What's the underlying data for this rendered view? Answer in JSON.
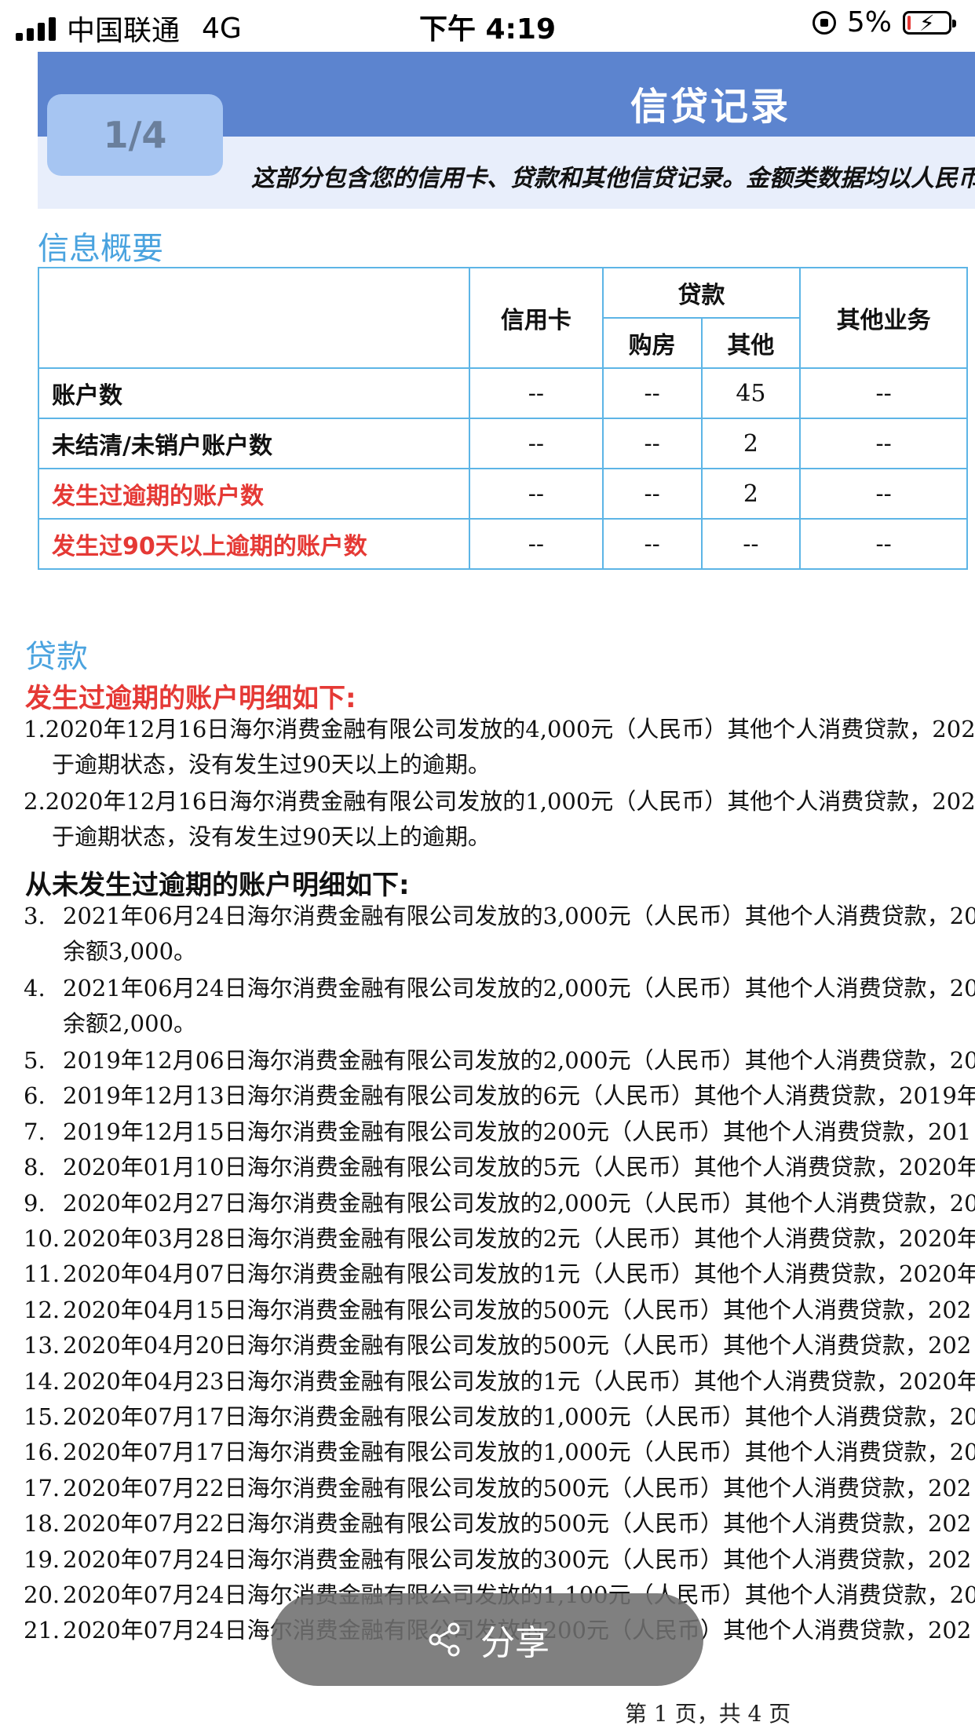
{
  "status_bar": {
    "carrier": "中国联通",
    "network": "4G",
    "time": "下午 4:19",
    "battery": "5%"
  },
  "header": {
    "title": "信贷记录",
    "page_badge": "1/4",
    "description": "这部分包含您的信用卡、贷款和其他信贷记录。金额类数据均以人民币"
  },
  "summary": {
    "title": "信息概要",
    "headers": {
      "credit_card": "信用卡",
      "loan": "贷款",
      "housing": "购房",
      "other": "其他",
      "other_business": "其他业务"
    },
    "rows": [
      {
        "label": "账户数",
        "credit_card": "--",
        "housing": "--",
        "other": "45",
        "other_business": "--"
      },
      {
        "label": "未结清/未销户账户数",
        "credit_card": "--",
        "housing": "--",
        "other": "2",
        "other_business": "--"
      },
      {
        "label": "发生过逾期的账户数",
        "credit_card": "--",
        "housing": "--",
        "other": "2",
        "other_business": "--"
      },
      {
        "label": "发生过90天以上逾期的账户数",
        "credit_card": "--",
        "housing": "--",
        "other": "--",
        "other_business": "--"
      }
    ]
  },
  "loans": {
    "title": "贷款",
    "overdue_heading": "发生过逾期的账户明细如下:",
    "overdue_items": [
      {
        "num": "1.",
        "line1": "2020年12月16日海尔消费金融有限公司发放的4,000元（人民币）其他个人消费贷款，202",
        "line2": "于逾期状态，没有发生过90天以上的逾期。"
      },
      {
        "num": "2.",
        "line1": "2020年12月16日海尔消费金融有限公司发放的1,000元（人民币）其他个人消费贷款，202",
        "line2": "于逾期状态，没有发生过90天以上的逾期。"
      }
    ],
    "normal_heading": "从未发生过逾期的账户明细如下:",
    "normal_items_two_line": [
      {
        "num": "3.",
        "line1": "2021年06月24日海尔消费金融有限公司发放的3,000元（人民币）其他个人消费贷款，20",
        "line2": "余额3,000。"
      },
      {
        "num": "4.",
        "line1": "2021年06月24日海尔消费金融有限公司发放的2,000元（人民币）其他个人消费贷款，20",
        "line2": "余额2,000。"
      }
    ],
    "normal_items": [
      {
        "num": "5.",
        "text": "2019年12月06日海尔消费金融有限公司发放的2,000元（人民币）其他个人消费贷款，20"
      },
      {
        "num": "6.",
        "text": "2019年12月13日海尔消费金融有限公司发放的6元（人民币）其他个人消费贷款，2019年"
      },
      {
        "num": "7.",
        "text": "2019年12月15日海尔消费金融有限公司发放的200元（人民币）其他个人消费贷款，201"
      },
      {
        "num": "8.",
        "text": "2020年01月10日海尔消费金融有限公司发放的5元（人民币）其他个人消费贷款，2020年"
      },
      {
        "num": "9.",
        "text": "2020年02月27日海尔消费金融有限公司发放的2,000元（人民币）其他个人消费贷款，20"
      },
      {
        "num": "10.",
        "text": "2020年03月28日海尔消费金融有限公司发放的2元（人民币）其他个人消费贷款，2020年"
      },
      {
        "num": "11.",
        "text": "2020年04月07日海尔消费金融有限公司发放的1元（人民币）其他个人消费贷款，2020年"
      },
      {
        "num": "12.",
        "text": "2020年04月15日海尔消费金融有限公司发放的500元（人民币）其他个人消费贷款，202"
      },
      {
        "num": "13.",
        "text": "2020年04月20日海尔消费金融有限公司发放的500元（人民币）其他个人消费贷款，202"
      },
      {
        "num": "14.",
        "text": "2020年04月23日海尔消费金融有限公司发放的1元（人民币）其他个人消费贷款，2020年"
      },
      {
        "num": "15.",
        "text": "2020年07月17日海尔消费金融有限公司发放的1,000元（人民币）其他个人消费贷款，20"
      },
      {
        "num": "16.",
        "text": "2020年07月17日海尔消费金融有限公司发放的1,000元（人民币）其他个人消费贷款，20"
      },
      {
        "num": "17.",
        "text": "2020年07月22日海尔消费金融有限公司发放的500元（人民币）其他个人消费贷款，202"
      },
      {
        "num": "18.",
        "text": "2020年07月22日海尔消费金融有限公司发放的500元（人民币）其他个人消费贷款，202"
      },
      {
        "num": "19.",
        "text": "2020年07月24日海尔消费金融有限公司发放的300元（人民币）其他个人消费贷款，202"
      },
      {
        "num": "20.",
        "text": "2020年07月24日海尔消费金融有限公司发放的1,100元（人民币）其他个人消费贷款，20"
      },
      {
        "num": "21.",
        "text": "2020年07月24日海尔消费金融有限公司发放的200元（人民币）其他个人消费贷款，202"
      }
    ]
  },
  "share_button": {
    "label": "分享",
    "icon": "share-icon"
  },
  "footer": {
    "page_info": "第 1 页，共 4 页"
  }
}
